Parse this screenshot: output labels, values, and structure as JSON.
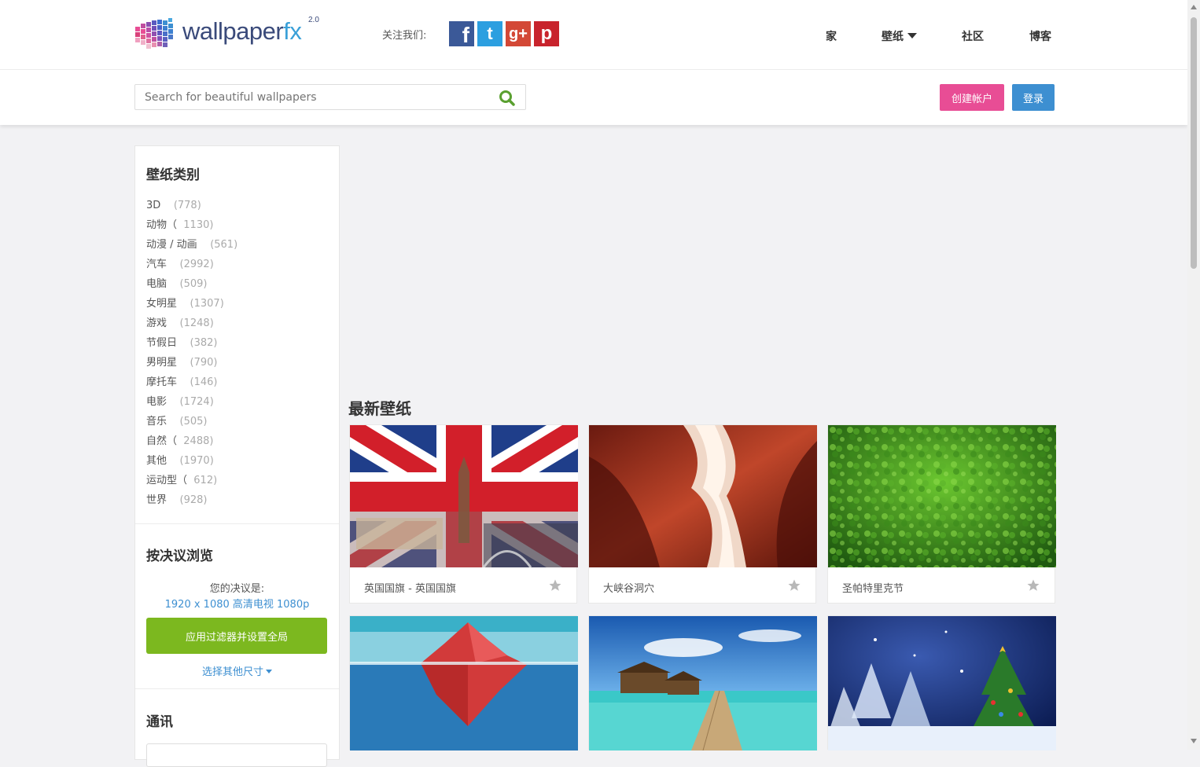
{
  "header": {
    "logo_text": "wallpaper",
    "logo_fx": "fx",
    "logo_version": "2.0",
    "follow_label": "关注我们:",
    "social": {
      "facebook": "f",
      "twitter": "t",
      "googleplus": "g+",
      "pinterest": "p"
    },
    "nav": [
      {
        "label": "家"
      },
      {
        "label": "壁纸"
      },
      {
        "label": "社区"
      },
      {
        "label": "博客"
      }
    ]
  },
  "search": {
    "placeholder": "Search for beautiful wallpapers"
  },
  "account": {
    "create_label": "创建帐户",
    "login_label": "登录"
  },
  "colors": {
    "create_button": "#e84d95",
    "login_button": "#3d8fd1",
    "apply_button": "#7cb81f",
    "link": "#3d8fd1"
  },
  "sidebar": {
    "categories_title": "壁纸类别",
    "categories": [
      {
        "name": "3D",
        "count": "(778)"
      },
      {
        "name": "动物（",
        "count": "1130)"
      },
      {
        "name": "动漫 / 动画",
        "count": "(561)"
      },
      {
        "name": "汽车",
        "count": "(2992)"
      },
      {
        "name": "电脑",
        "count": "(509)"
      },
      {
        "name": "女明星",
        "count": "(1307)"
      },
      {
        "name": "游戏",
        "count": "(1248)"
      },
      {
        "name": "节假日",
        "count": "(382)"
      },
      {
        "name": "男明星",
        "count": "(790)"
      },
      {
        "name": "摩托车",
        "count": "(146)"
      },
      {
        "name": "电影",
        "count": "(1724)"
      },
      {
        "name": "音乐",
        "count": "(505)"
      },
      {
        "name": "自然（",
        "count": "2488)"
      },
      {
        "name": "其他",
        "count": "(1970)"
      },
      {
        "name": "运动型（",
        "count": "612)"
      },
      {
        "name": "世界",
        "count": "(928)"
      }
    ],
    "resolution_title": "按决议浏览",
    "resolution_label": "您的决议是:",
    "resolution_value": "1920 x 1080 高清电视 1080p",
    "apply_label": "应用过滤器并设置全局",
    "other_size_label": "选择其他尺寸",
    "newsletter_title": "通讯"
  },
  "main": {
    "latest_title": "最新壁纸",
    "wallpapers": [
      {
        "title": "英国国旗 - 英国国旗",
        "icon": "star-icon"
      },
      {
        "title": "大峡谷洞穴",
        "icon": "star-icon"
      },
      {
        "title": "圣帕特里克节",
        "icon": "star-icon"
      }
    ]
  }
}
